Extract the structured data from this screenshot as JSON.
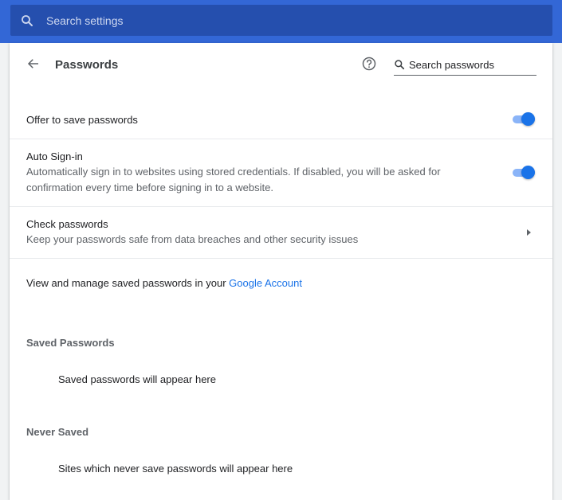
{
  "search_settings": {
    "placeholder": "Search settings",
    "icon": "search-icon"
  },
  "header": {
    "title": "Passwords",
    "back_icon": "arrow-back-icon",
    "help_icon": "help-icon",
    "search_placeholder": "Search passwords"
  },
  "offer_to_save": {
    "label": "Offer to save passwords",
    "enabled": true
  },
  "auto_sign_in": {
    "label": "Auto Sign-in",
    "description": "Automatically sign in to websites using stored credentials. If disabled, you will be asked for confirmation every time before signing in to a website.",
    "enabled": true
  },
  "check_passwords": {
    "label": "Check passwords",
    "description": "Keep your passwords safe from data breaches and other security issues"
  },
  "manage": {
    "prefix": "View and manage saved passwords in your ",
    "link_text": "Google Account"
  },
  "saved_passwords": {
    "title": "Saved Passwords",
    "empty_message": "Saved passwords will appear here"
  },
  "never_saved": {
    "title": "Never Saved",
    "empty_message": "Sites which never save passwords will appear here"
  },
  "colors": {
    "header_bg": "#3367d6",
    "search_bg": "#254fae",
    "accent": "#1a73e8",
    "toggle_track": "#8ab4f8"
  }
}
